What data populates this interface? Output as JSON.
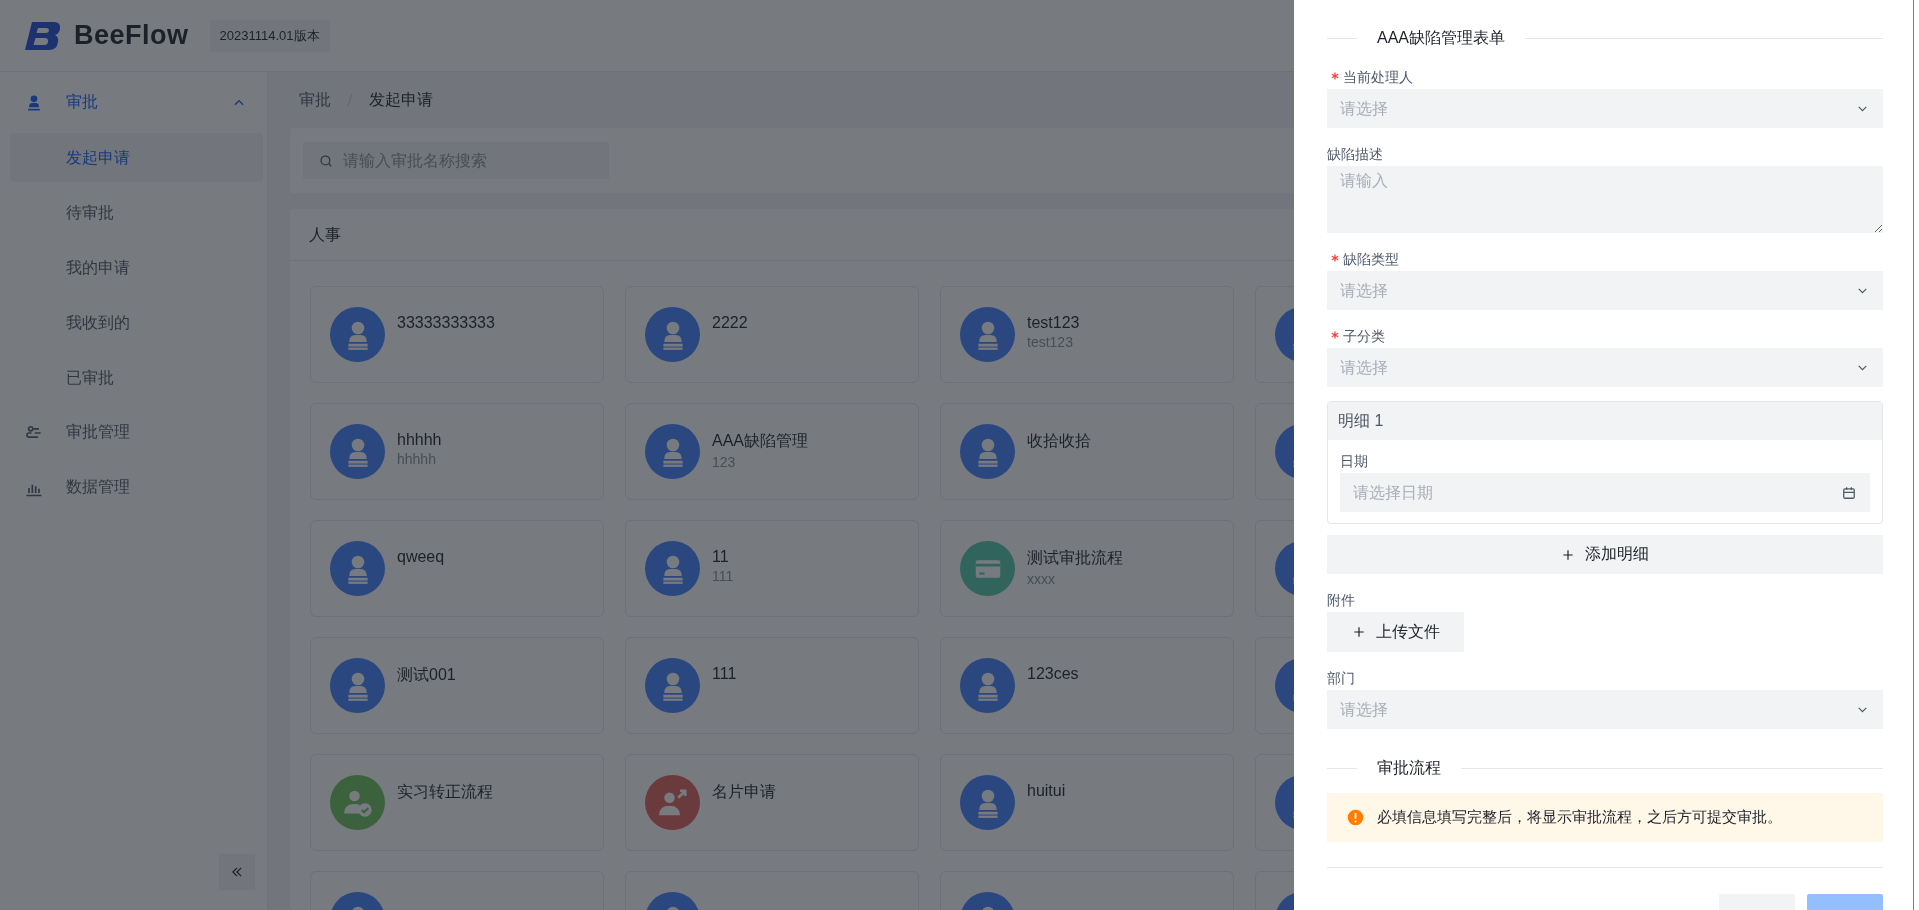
{
  "header": {
    "logo_text": "BeeFlow",
    "version": "20231114.01版本"
  },
  "sidebar": {
    "items": [
      {
        "label": "审批",
        "kind": "stamp",
        "expanded": true,
        "children": [
          {
            "label": "发起申请",
            "selected": true
          },
          {
            "label": "待审批",
            "selected": false
          },
          {
            "label": "我的申请",
            "selected": false
          },
          {
            "label": "我收到的",
            "selected": false
          },
          {
            "label": "已审批",
            "selected": false
          }
        ]
      },
      {
        "label": "审批管理",
        "kind": "flow"
      },
      {
        "label": "数据管理",
        "kind": "chart"
      }
    ]
  },
  "breadcrumb": [
    "审批",
    "发起申请"
  ],
  "search": {
    "placeholder": "请输入审批名称搜索"
  },
  "category": {
    "title": "人事",
    "cards": [
      {
        "title": "33333333333",
        "kind": "stamp"
      },
      {
        "title": "2222",
        "kind": "stamp"
      },
      {
        "title": "test123",
        "subtitle": "test123",
        "kind": "stamp"
      },
      {
        "kind": "stamp"
      },
      {
        "title": "hhhhh",
        "subtitle": "hhhhh",
        "kind": "stamp"
      },
      {
        "title": "AAA缺陷管理",
        "subtitle": "123",
        "kind": "stamp"
      },
      {
        "title": "收拾收拾",
        "kind": "stamp"
      },
      {
        "kind": "stamp"
      },
      {
        "title": "qweeq",
        "kind": "stamp"
      },
      {
        "title": "11",
        "subtitle": "111",
        "kind": "stamp"
      },
      {
        "title": "测试审批流程",
        "subtitle": "xxxx",
        "kind": "card"
      },
      {
        "kind": "stamp"
      },
      {
        "title": "测试001",
        "kind": "stamp"
      },
      {
        "title": "111",
        "kind": "stamp"
      },
      {
        "title": "123ces",
        "kind": "stamp"
      },
      {
        "kind": "stamp"
      },
      {
        "title": "实习转正流程",
        "kind": "user-check"
      },
      {
        "title": "名片申请",
        "kind": "user-share"
      },
      {
        "title": "huitui",
        "kind": "stamp"
      },
      {
        "kind": "stamp"
      },
      {
        "kind": "stamp"
      },
      {
        "kind": "stamp"
      },
      {
        "kind": "stamp"
      },
      {
        "kind": "stamp"
      }
    ]
  },
  "drawer": {
    "form_title": "AAA缺陷管理表单",
    "fields": [
      {
        "kind": "select",
        "label": "当前处理人",
        "required": true,
        "placeholder": "请选择"
      },
      {
        "kind": "textarea",
        "label": "缺陷描述",
        "required": false,
        "placeholder": "请输入"
      },
      {
        "kind": "select",
        "label": "缺陷类型",
        "required": true,
        "placeholder": "请选择"
      },
      {
        "kind": "select",
        "label": "子分类",
        "required": true,
        "placeholder": "请选择"
      },
      {
        "kind": "detail",
        "title": "明细 1",
        "fields": [
          {
            "kind": "date",
            "label": "日期",
            "required": false,
            "placeholder": "请选择日期"
          }
        ],
        "add_label": "添加明细"
      },
      {
        "kind": "upload",
        "label": "附件",
        "required": false,
        "button": "上传文件"
      },
      {
        "kind": "select",
        "label": "部门",
        "required": false,
        "placeholder": "请选择"
      }
    ],
    "flow_title": "审批流程",
    "alert": "必填信息填写完整后，将显示审批流程，之后方可提交审批。",
    "footer_buttons": [
      {
        "kind": "default"
      },
      {
        "kind": "primary"
      }
    ]
  }
}
